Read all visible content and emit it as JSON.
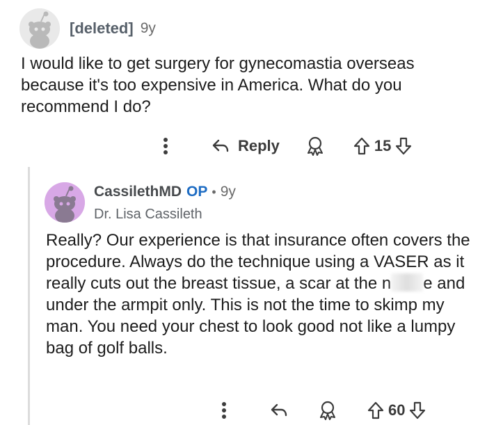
{
  "comments": [
    {
      "author": "[deleted]",
      "age": "9y",
      "body": "I would like to get surgery for gynecomastia overseas because it's too expensive in America. What do you recommend I do?",
      "actions": {
        "reply_label": "Reply",
        "score": "15"
      }
    },
    {
      "author": "CassilethMD",
      "op_badge": "OP",
      "separator": "•",
      "age": "9y",
      "flair": "Dr. Lisa Cassileth",
      "body_before": "Really? Our experience is that insurance often covers the procedure. Always do the technique using a VASER as it really cuts out the breast tissue, a scar at the n",
      "body_after": "e and under the armpit only. This is not the time to skimp my man. You need your chest to look good not like a lumpy bag of golf balls.",
      "actions": {
        "score": "60"
      }
    }
  ],
  "colors": {
    "op_blue": "#1e6cc3",
    "avatar_purple": "#d8a8e6",
    "avatar_grey": "#e9e9e9",
    "thread_line": "#dcdcdc"
  },
  "icons": [
    "snoo-avatar-icon",
    "kebab-menu-icon",
    "reply-arrow-icon",
    "award-icon",
    "upvote-icon",
    "downvote-icon"
  ]
}
